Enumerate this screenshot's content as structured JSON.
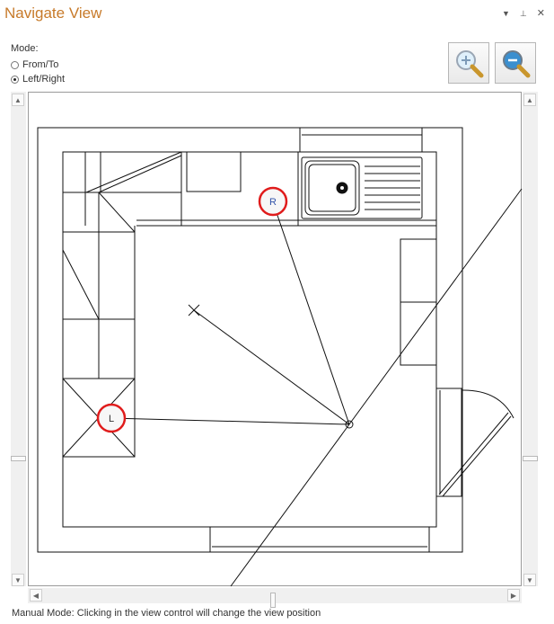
{
  "panel": {
    "title": "Navigate View",
    "dropdown_icon": "dropdown-arrow-icon",
    "pin_icon": "pin-icon",
    "close_icon": "close-icon"
  },
  "mode": {
    "label": "Mode:",
    "options": [
      {
        "label": "From/To",
        "selected": false
      },
      {
        "label": "Left/Right",
        "selected": true
      }
    ]
  },
  "zoom": {
    "zoom_in_icon": "zoom-in-icon",
    "zoom_out_icon": "zoom-out-icon"
  },
  "view": {
    "marker_left": "L",
    "marker_right": "R",
    "accent_color": "#e01c1c"
  },
  "status": {
    "text": "Manual Mode: Clicking in the view control will change the view position"
  }
}
